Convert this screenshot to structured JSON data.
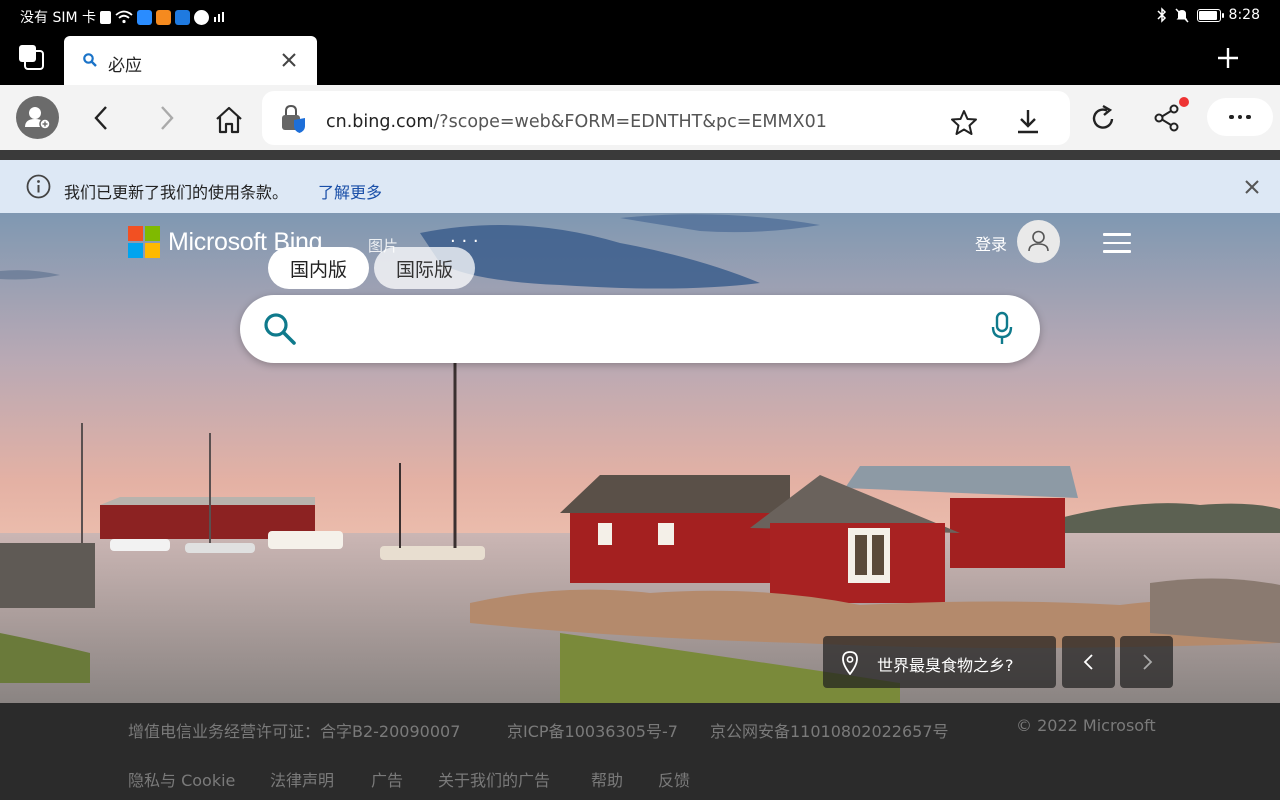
{
  "status_bar": {
    "carrier": "没有 SIM 卡",
    "time": "8:28",
    "battery_level": 0.9,
    "app_icon_colors": [
      "#ffffff",
      "#2a8cff",
      "#f58a1f",
      "#1f7ae0",
      "#ffffff"
    ]
  },
  "tab": {
    "title": "必应"
  },
  "toolbar": {
    "url_host": "cn.bing.com",
    "url_rest": "/?scope=web&FORM=EDNTHT&pc=EMMX01"
  },
  "banner": {
    "text": "我们已更新了我们的使用条款。",
    "link": "了解更多"
  },
  "bing": {
    "logo_text": "Microsoft Bing",
    "nav_images": "图片",
    "nav_more": "· · ·",
    "tab_domestic": "国内版",
    "tab_international": "国际版",
    "login": "登录",
    "search_placeholder": "",
    "caption": "世界最臭食物之乡?",
    "logo_colors": [
      "#f25022",
      "#7fba00",
      "#00a4ef",
      "#ffb900"
    ],
    "accent": "#0f7a8c"
  },
  "footer": {
    "license": "增值电信业务经营许可证：合字B2-20090007",
    "icp": "京ICP备10036305号-7",
    "police": "京公网安备11010802022657号",
    "copyright": "© 2022 Microsoft",
    "links": [
      "隐私与 Cookie",
      "法律声明",
      "广告",
      "关于我们的广告",
      "帮助",
      "反馈"
    ]
  }
}
